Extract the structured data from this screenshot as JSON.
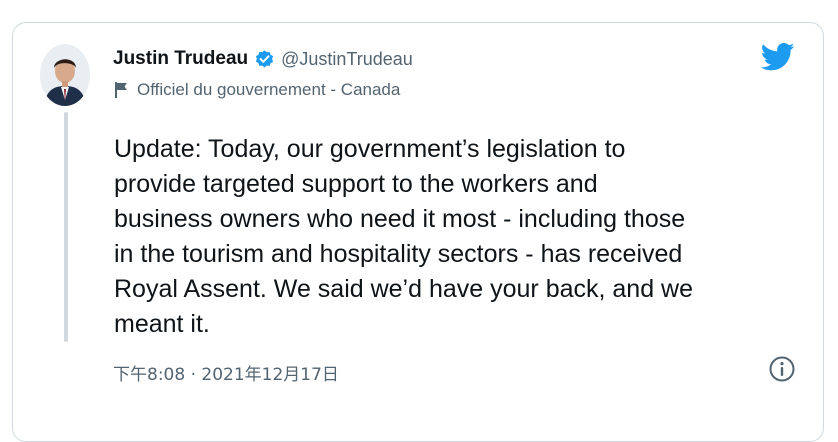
{
  "author": {
    "display_name": "Justin Trudeau",
    "handle": "@JustinTrudeau",
    "verified": true,
    "account_label": "Officiel du gouvernement - Canada"
  },
  "tweet": {
    "text": "Update: Today, our government’s legislation to\nprovide targeted support to the workers and\nbusiness owners who need it most - including those\nin the tourism and hospitality sectors - has received\nRoyal Assent. We said we’d have your back, and we\nmeant it.",
    "timestamp": "下午8:08 · 2021年12月17日"
  },
  "icons": {
    "brand": "twitter-bird-icon",
    "verified": "verified-badge-icon",
    "label": "flag-icon",
    "info": "info-icon"
  },
  "colors": {
    "twitter_blue": "#1d9bf0",
    "secondary_text": "#536471",
    "primary_text": "#0f1419",
    "border": "#cfd9de"
  }
}
